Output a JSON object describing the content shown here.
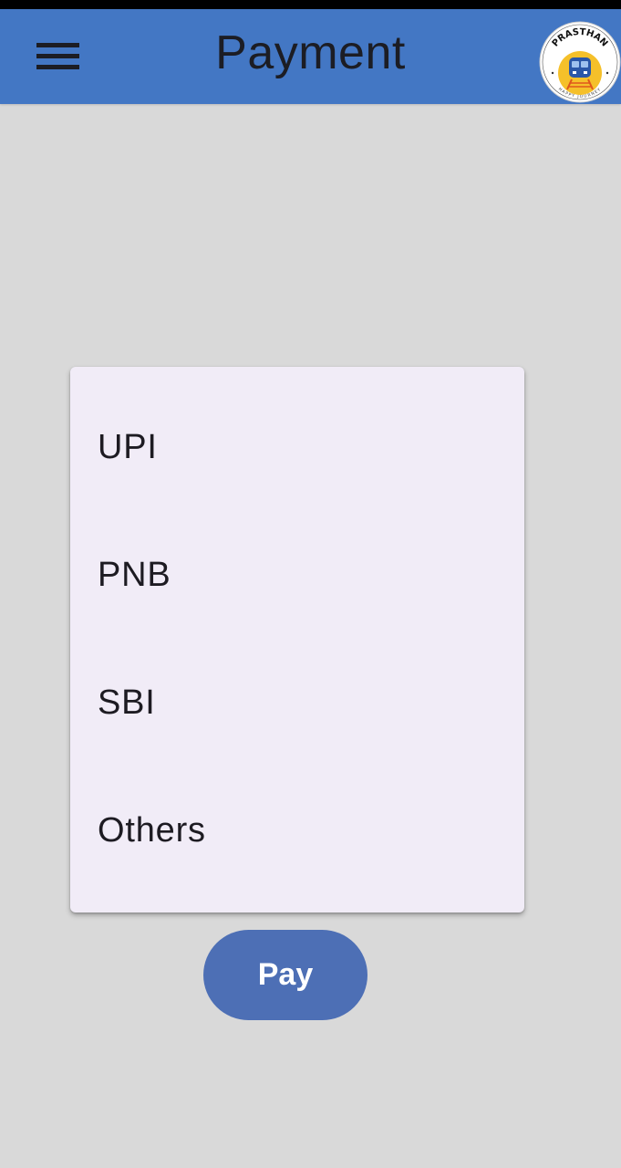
{
  "app_bar": {
    "title": "Payment",
    "menu_icon": "hamburger-menu-icon",
    "background_color": "#4377c4",
    "logo": {
      "top_text": "PRASTHAN",
      "bottom_text": "HAPPY JOURNEY",
      "icon": "train-icon"
    }
  },
  "payment_menu": {
    "items": [
      {
        "label": "UPI"
      },
      {
        "label": "PNB"
      },
      {
        "label": "SBI"
      },
      {
        "label": "Others"
      }
    ]
  },
  "pay_button": {
    "label": "Pay",
    "color": "#4d6fb5"
  }
}
